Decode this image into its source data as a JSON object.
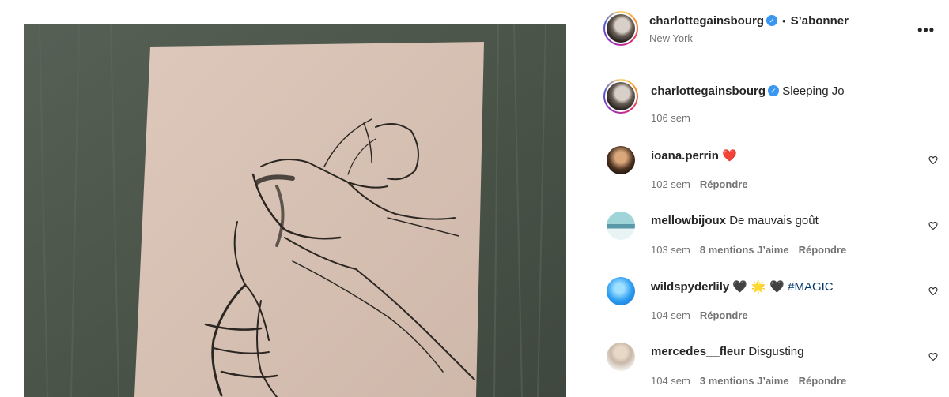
{
  "post": {
    "author": "charlottegainsbourg",
    "follow_label": "S’abonner",
    "dot": "•",
    "location": "New York",
    "more": "•••"
  },
  "caption": {
    "author": "charlottegainsbourg",
    "text": "Sleeping Jo",
    "time": "106 sem"
  },
  "comments": [
    {
      "user": "ioana.perrin",
      "text": "❤️",
      "time": "102 sem",
      "likes": "",
      "reply": "Répondre"
    },
    {
      "user": "mellowbijoux",
      "text": "De mauvais goût",
      "time": "103 sem",
      "likes": "8 mentions J’aime",
      "reply": "Répondre"
    },
    {
      "user": "wildspyderlily",
      "text": "🖤 🌟 🖤",
      "hashtag": "#MAGIC",
      "time": "104 sem",
      "likes": "",
      "reply": "Répondre"
    },
    {
      "user": "mercedes__fleur",
      "text": "Disgusting",
      "time": "104 sem",
      "likes": "3 mentions J’aime",
      "reply": "Répondre"
    }
  ],
  "colors": {
    "verified": "#3897f0",
    "link": "#00376b",
    "muted": "#737373",
    "background_cloth": "#4a5448",
    "paper": "#d9c3b6"
  }
}
